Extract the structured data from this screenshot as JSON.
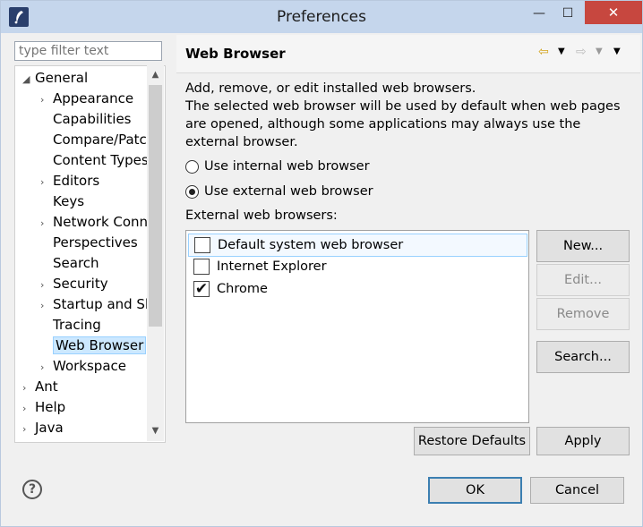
{
  "window": {
    "title": "Preferences",
    "min_glyph": "—",
    "max_glyph": "☐",
    "close_glyph": "✕"
  },
  "filter": {
    "placeholder": "type filter text"
  },
  "tree": {
    "items": [
      {
        "label": "General",
        "arrow": "◢"
      },
      {
        "label": "Appearance",
        "arrow": "›"
      },
      {
        "label": "Capabilities",
        "arrow": ""
      },
      {
        "label": "Compare/Patc",
        "arrow": ""
      },
      {
        "label": "Content Types",
        "arrow": ""
      },
      {
        "label": "Editors",
        "arrow": "›"
      },
      {
        "label": "Keys",
        "arrow": ""
      },
      {
        "label": "Network Conn",
        "arrow": "›"
      },
      {
        "label": "Perspectives",
        "arrow": ""
      },
      {
        "label": "Search",
        "arrow": ""
      },
      {
        "label": "Security",
        "arrow": "›"
      },
      {
        "label": "Startup and Sh",
        "arrow": "›"
      },
      {
        "label": "Tracing",
        "arrow": ""
      },
      {
        "label": "Web Browser",
        "arrow": ""
      },
      {
        "label": "Workspace",
        "arrow": "›"
      },
      {
        "label": "Ant",
        "arrow": "›"
      },
      {
        "label": "Help",
        "arrow": "›"
      },
      {
        "label": "Java",
        "arrow": "›"
      }
    ],
    "scroll_up": "▲",
    "scroll_down": "▼"
  },
  "page": {
    "title": "Web Browser",
    "nav": {
      "back": "⇦",
      "forward": "⇨",
      "menu": "▼"
    },
    "desc_line1": "Add, remove, or edit installed web browsers.",
    "desc_line2": "The selected web browser will be used by default when web pages are opened, although some applications may always use the external browser.",
    "radio_internal": "Use internal web browser",
    "radio_external": "Use external web browser",
    "list_label": "External web browsers:",
    "browsers": [
      {
        "name": "Default system web browser",
        "checked": false
      },
      {
        "name": "Internet Explorer",
        "checked": false
      },
      {
        "name": "Chrome",
        "checked": true
      }
    ],
    "check_mark": "✔",
    "buttons": {
      "new": "New...",
      "edit": "Edit...",
      "remove": "Remove",
      "search": "Search...",
      "restore": "Restore Defaults",
      "apply": "Apply"
    }
  },
  "footer": {
    "help": "?",
    "ok": "OK",
    "cancel": "Cancel"
  }
}
